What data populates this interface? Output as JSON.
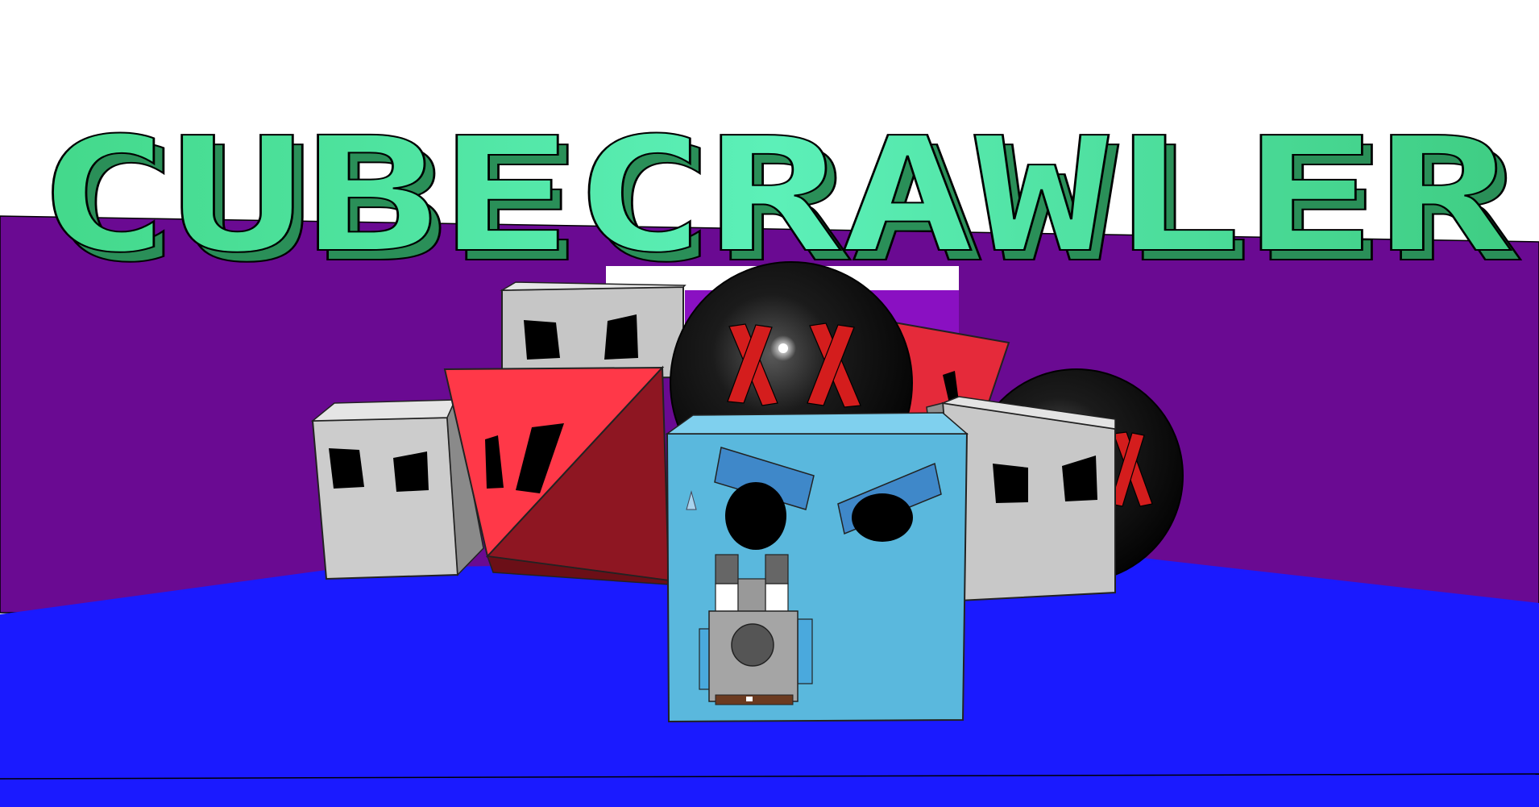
{
  "game": {
    "title": "CUBECRAWLER",
    "title_text": [
      "C",
      "U",
      "B",
      "E",
      "C",
      "R",
      "A",
      "W",
      "L",
      "E",
      "R"
    ]
  },
  "colors": {
    "sky": "#ffffff",
    "wall": "#6a0a92",
    "floor": "#1a1aff",
    "title_face": "#4ee89a",
    "title_side": "#2fa967",
    "title_top": "#9ef7c7",
    "player_cube": "#5ab8dd",
    "player_brow": "#3f88c9",
    "grey_enemy": "#c8c8c8",
    "red_enemy": "#f0323f",
    "bomb_enemy": "#0a0a0a",
    "bomb_x": "#d41d1d"
  },
  "characters": {
    "player": "player-cube",
    "enemies": [
      "grey-cube-enemy",
      "grey-cube-enemy",
      "grey-cube-enemy",
      "red-pyramid-enemy",
      "red-pyramid-enemy",
      "bomb-sphere-enemy",
      "bomb-sphere-enemy"
    ]
  }
}
